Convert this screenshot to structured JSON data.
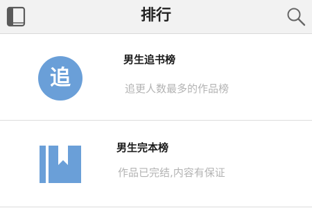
{
  "header": {
    "title": "排行",
    "left_icon": "book-icon",
    "right_icon": "search-icon"
  },
  "rankings": [
    {
      "title": "男生追书榜",
      "subtitle": "追更人数最多的作品榜",
      "icon": "chase-circle-icon",
      "icon_glyph": "追"
    },
    {
      "title": "男生完本榜",
      "subtitle": "作品已完结,内容有保证",
      "icon": "bookmark-book-icon"
    }
  ],
  "colors": {
    "header_bg": "#f2f2f2",
    "accent_blue": "#6a9fd8",
    "subtitle_gray": "#b3b3b3"
  }
}
